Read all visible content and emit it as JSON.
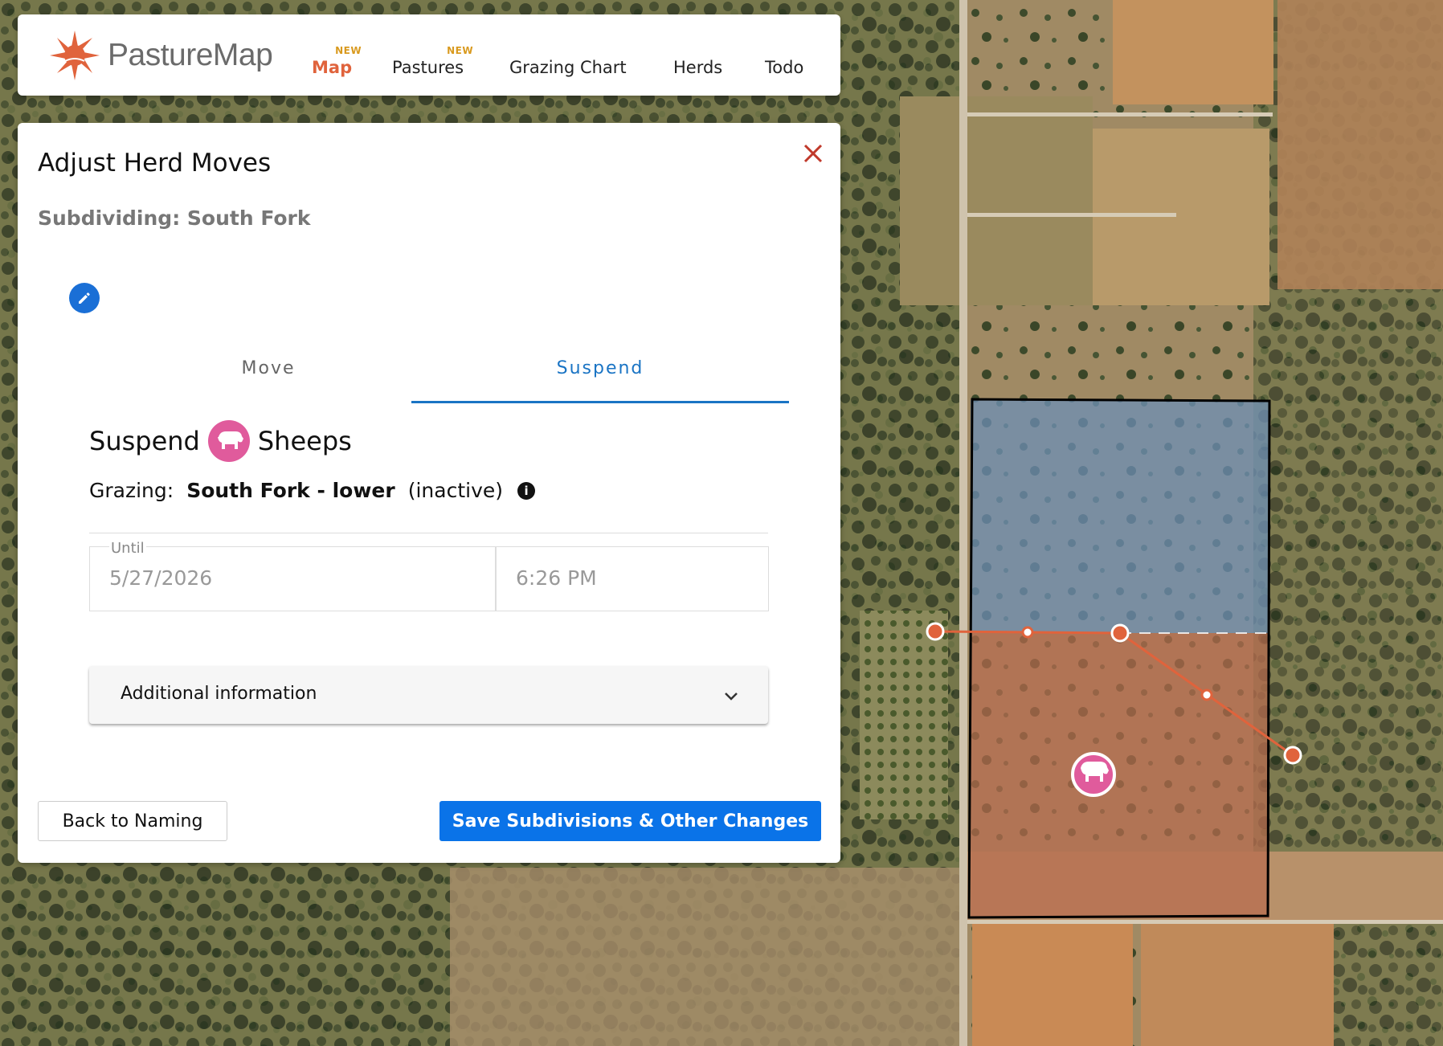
{
  "brand": {
    "name": "PastureMap"
  },
  "nav": [
    {
      "label": "Map",
      "badge": "NEW",
      "active": true
    },
    {
      "label": "Pastures",
      "badge": "NEW",
      "active": false
    },
    {
      "label": "Grazing Chart",
      "badge": "",
      "active": false
    },
    {
      "label": "Herds",
      "badge": "",
      "active": false
    },
    {
      "label": "Todo",
      "badge": "",
      "active": false
    }
  ],
  "panel": {
    "title": "Adjust Herd Moves",
    "subtitle": "Subdividing: South Fork",
    "tabs": [
      {
        "label": "Move",
        "active": false
      },
      {
        "label": "Suspend",
        "active": true
      }
    ],
    "suspend": {
      "verb": "Suspend",
      "herd_name": "Sheeps",
      "grazing_label": "Grazing:",
      "grazing_value": "South Fork - lower",
      "grazing_status": "(inactive)"
    },
    "until": {
      "label": "Until",
      "date": "5/27/2026",
      "time": "6:26 PM"
    },
    "additional_info": "Additional information",
    "back_button": "Back to Naming",
    "save_button": "Save Subdivisions & Other Changes"
  },
  "colors": {
    "accent": "#e0633c",
    "primary": "#0a73e8",
    "herd": "#e05b9c",
    "close": "#c0392b"
  }
}
